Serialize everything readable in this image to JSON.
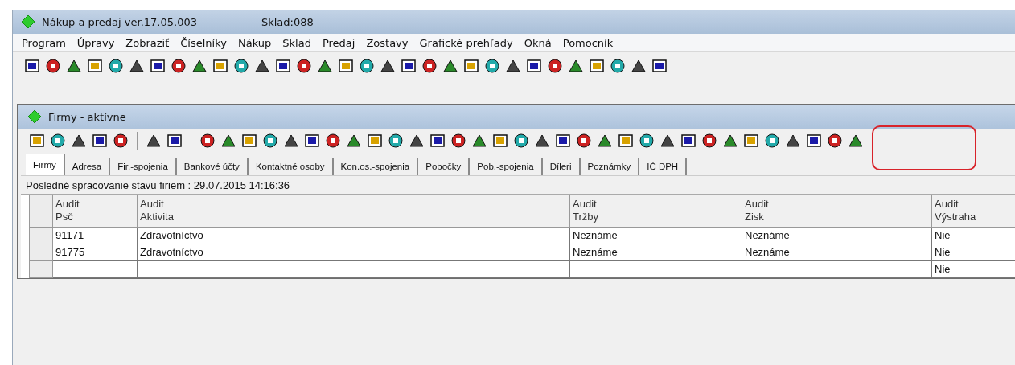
{
  "window": {
    "title": "Nákup a predaj ver.17.05.003",
    "warehouse": "Sklad:088"
  },
  "menu": [
    "Program",
    "Úpravy",
    "Zobraziť",
    "Číselníky",
    "Nákup",
    "Sklad",
    "Predaj",
    "Zostavy",
    "Grafické prehľady",
    "Okná",
    "Pomocník"
  ],
  "child_window": {
    "title": "Firmy - aktívne"
  },
  "tabs": [
    {
      "label": "Firmy",
      "selected": true
    },
    {
      "label": "Adresa",
      "selected": false
    },
    {
      "label": "Fir.-spojenia",
      "selected": false
    },
    {
      "label": "Bankové účty",
      "selected": false
    },
    {
      "label": "Kontaktné osoby",
      "selected": false
    },
    {
      "label": "Kon.os.-spojenia",
      "selected": false
    },
    {
      "label": "Pobočky",
      "selected": false
    },
    {
      "label": "Pob.-spojenia",
      "selected": false
    },
    {
      "label": "Díleri",
      "selected": false
    },
    {
      "label": "Poznámky",
      "selected": false
    },
    {
      "label": "IČ DPH",
      "selected": false
    }
  ],
  "status": "Posledné spracovanie stavu firiem : 29.07.2015 14:16:36",
  "table": {
    "columns": [
      "Audit\nPsč",
      "Audit\nAktivita",
      "Audit\nTržby",
      "Audit\nZisk",
      "Audit\nVýstraha"
    ],
    "rows": [
      [
        "91171",
        "Zdravotníctvo",
        "Neznáme",
        "Neznáme",
        "Nie"
      ],
      [
        "91775",
        "Zdravotníctvo",
        "Neznáme",
        "Neznáme",
        "Nie"
      ],
      [
        "",
        "",
        "",
        "",
        "Nie"
      ]
    ]
  }
}
